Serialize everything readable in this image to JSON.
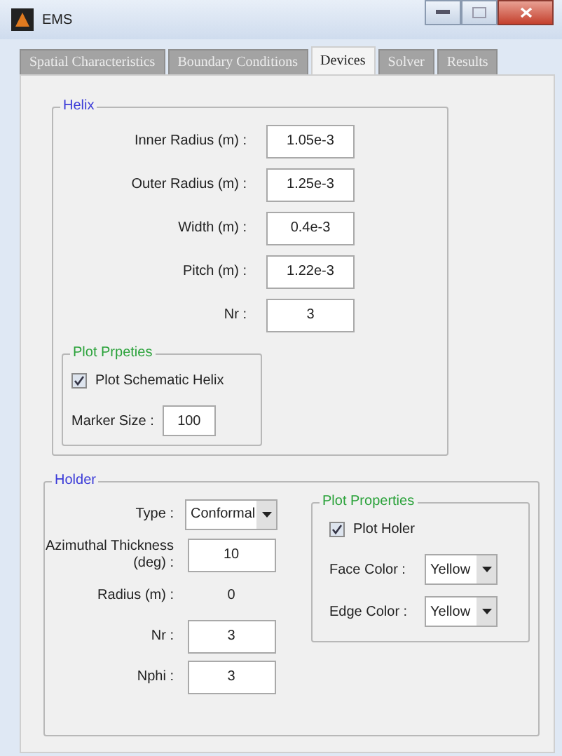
{
  "window": {
    "title": "EMS"
  },
  "tabs": [
    {
      "label": "Spatial Characteristics",
      "selected": false
    },
    {
      "label": "Boundary Conditions",
      "selected": false
    },
    {
      "label": "Devices",
      "selected": true
    },
    {
      "label": "Solver",
      "selected": false
    },
    {
      "label": "Results",
      "selected": false
    }
  ],
  "helix": {
    "title": "Helix",
    "fields": [
      {
        "label": "Inner Radius (m) :",
        "value": "1.05e-3"
      },
      {
        "label": "Outer Radius (m) :",
        "value": "1.25e-3"
      },
      {
        "label": "Width (m) :",
        "value": "0.4e-3"
      },
      {
        "label": "Pitch (m) :",
        "value": "1.22e-3"
      },
      {
        "label": "Nr :",
        "value": "3"
      }
    ],
    "plot_properties": {
      "title": "Plot Prpeties",
      "checkbox": {
        "label": "Plot Schematic Helix",
        "checked": true
      },
      "marker_size": {
        "label": "Marker Size :",
        "value": "100"
      }
    }
  },
  "holder": {
    "title": "Holder",
    "rows": [
      {
        "kind": "dropdown",
        "label": "Type :",
        "value": "Conformal"
      },
      {
        "kind": "field",
        "label": "Azimuthal Thickness (deg) :",
        "value": "10"
      },
      {
        "kind": "text",
        "label": "Radius (m) :",
        "value": "0"
      },
      {
        "kind": "field",
        "label": "Nr :",
        "value": "3"
      },
      {
        "kind": "field",
        "label": "Nphi :",
        "value": "3"
      }
    ],
    "plot_properties": {
      "title": "Plot Properties",
      "checkbox": {
        "label": "Plot Holer",
        "checked": true
      },
      "colors": [
        {
          "label": "Face Color :",
          "value": "Yellow"
        },
        {
          "label": "Edge Color :",
          "value": "Yellow"
        }
      ]
    }
  }
}
